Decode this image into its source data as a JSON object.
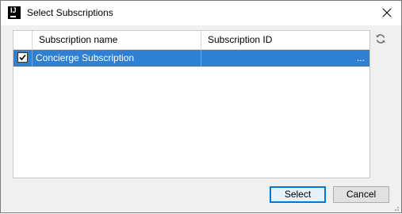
{
  "window": {
    "title": "Select Subscriptions",
    "app_icon": "intellij-icon",
    "close_icon": "close-icon"
  },
  "table": {
    "columns": [
      "Subscription name",
      "Subscription ID"
    ],
    "rows": [
      {
        "checked": true,
        "name": "Concierge Subscription",
        "id": "...",
        "selected": true
      }
    ],
    "refresh_icon": "refresh-icon"
  },
  "buttons": {
    "select_label": "Select",
    "cancel_label": "Cancel"
  },
  "colors": {
    "selection": "#2f7fd3",
    "default_button_border": "#0078d7"
  }
}
